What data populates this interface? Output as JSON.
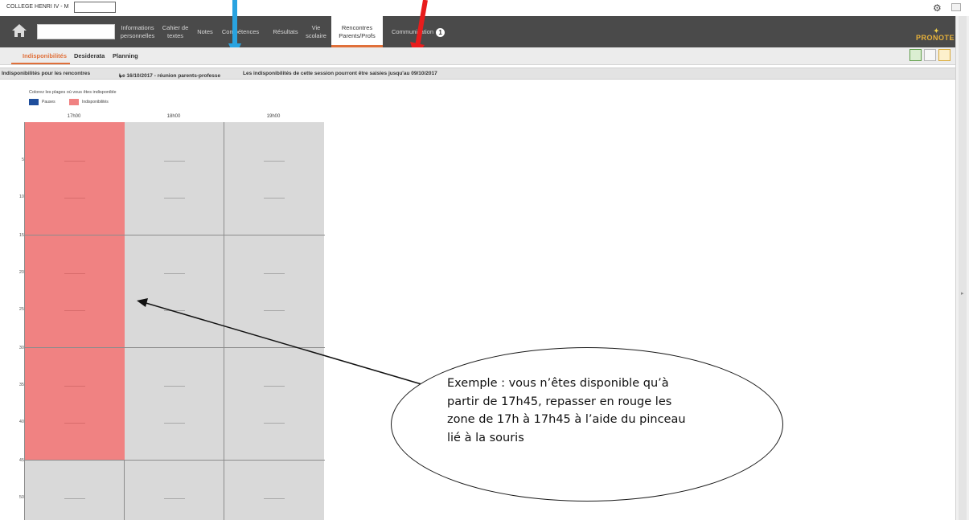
{
  "window": {
    "title": "COLLEGE HENRI IV - M"
  },
  "nav": {
    "items": [
      {
        "label": "Informations personnelles"
      },
      {
        "label": "Cahier de textes"
      },
      {
        "label": "Notes"
      },
      {
        "label": "Compétences"
      },
      {
        "label": "Résultats"
      },
      {
        "label": "Vie scolaire"
      },
      {
        "label": "Rencontres Parents/Profs"
      },
      {
        "label": "Communication"
      }
    ],
    "communication_badge": "1",
    "brand": "PRONOTE"
  },
  "subtabs": [
    "Indisponibilités",
    "Desiderata",
    "Planning"
  ],
  "filter": {
    "label": "Indisponibilités pour les rencontres",
    "session": "Le 16/10/2017 - réunion parents-professe",
    "note": "Les indisponibilités de cette session pourront être saisies jusqu'au 09/10/2017"
  },
  "legend": {
    "title": "Colorez les plages où vous êtes indisponible",
    "items": [
      {
        "label": "Pauses",
        "color": "#1f4e9c"
      },
      {
        "label": "Indisponibilités",
        "color": "#f08282"
      }
    ]
  },
  "grid": {
    "columns": [
      "17h00",
      "18h00",
      "19h00"
    ],
    "row_labels": [
      "5",
      "10",
      "15",
      "20",
      "25",
      "30",
      "35",
      "40",
      "45",
      "50"
    ],
    "unavailable_color": "#f08282",
    "available_color": "#d9d9d9",
    "unavailable_until_minute": 45
  },
  "annotation": {
    "lines": [
      "Exemple : vous n’êtes disponible qu’à",
      "partir de 17h45, repasser en rouge les",
      "zone de 17h à 17h45 à l’aide du pinceau",
      "lié à la souris"
    ]
  },
  "colors": {
    "accent": "#e0703a",
    "navbar": "#4a4a4a",
    "blue_arrow": "#29a3e0",
    "red_arrow": "#e81c1c"
  }
}
